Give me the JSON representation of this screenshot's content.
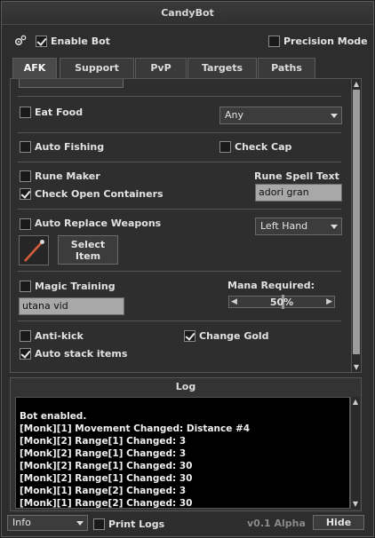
{
  "window": {
    "title": "CandyBot"
  },
  "header": {
    "enable_bot": {
      "label": "Enable Bot",
      "checked": true
    },
    "precision_mode": {
      "label": "Precision Mode",
      "checked": false
    }
  },
  "tabs": [
    {
      "label": "AFK",
      "active": true
    },
    {
      "label": "Support",
      "active": false
    },
    {
      "label": "PvP",
      "active": false
    },
    {
      "label": "Targets",
      "active": false
    },
    {
      "label": "Paths",
      "active": false
    }
  ],
  "afk": {
    "eat_food": {
      "label": "Eat Food",
      "checked": false
    },
    "food_select": "Any",
    "auto_fishing": {
      "label": "Auto Fishing",
      "checked": false
    },
    "check_cap": {
      "label": "Check Cap",
      "checked": false
    },
    "rune_maker": {
      "label": "Rune Maker",
      "checked": false
    },
    "rune_spell_label": "Rune Spell Text",
    "rune_spell_value": "adori gran",
    "check_open_containers": {
      "label": "Check Open Containers",
      "checked": true
    },
    "auto_replace_weapons": {
      "label": "Auto Replace Weapons",
      "checked": false
    },
    "hand_select": "Left Hand",
    "select_item_label": "Select Item",
    "magic_training": {
      "label": "Magic Training",
      "checked": false
    },
    "magic_spell_value": "utana vid",
    "mana_required_label": "Mana Required:",
    "mana_required_value": "50%",
    "mana_required_percent": 50,
    "anti_kick": {
      "label": "Anti-kick",
      "checked": false
    },
    "change_gold": {
      "label": "Change Gold",
      "checked": true
    },
    "auto_stack_items": {
      "label": "Auto stack items",
      "checked": true
    }
  },
  "log": {
    "title": "Log",
    "lines": [
      "Bot enabled.",
      "[Monk][1] Movement Changed: Distance #4",
      "[Monk][2] Range[1] Changed: 3",
      "[Monk][2] Range[1] Changed: 3",
      "[Monk][2] Range[1] Changed: 30",
      "[Monk][2] Range[1] Changed: 30",
      "[Monk][1] Range[2] Changed: 3",
      "[Monk][1] Range[2] Changed: 30"
    ]
  },
  "footer": {
    "level_select": "Info",
    "print_logs": {
      "label": "Print Logs",
      "checked": false
    },
    "version": "v0.1 Alpha",
    "hide_label": "Hide"
  },
  "colors": {
    "background": "#2d2d2d",
    "field": "#a8a8a8",
    "log_bg": "#000000",
    "scroll_thumb": "#9c9c9c"
  }
}
